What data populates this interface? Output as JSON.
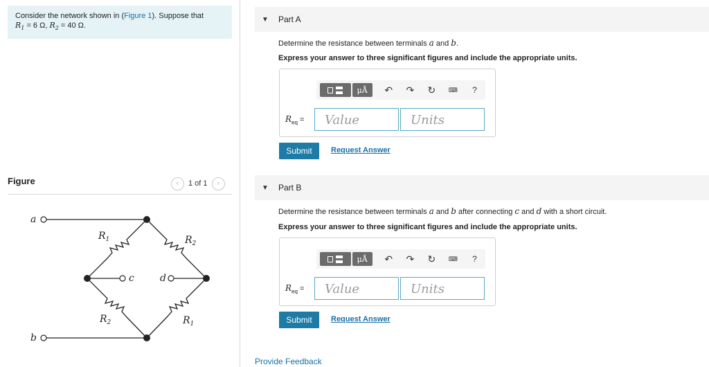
{
  "problem": {
    "text_prefix": "Consider the network shown in (",
    "figure_link": "Figure 1",
    "text_suffix": "). Suppose that",
    "r1_label": "R",
    "r1_sub": "1",
    "r1_value": " = 6 Ω",
    "separator": ", ",
    "r2_label": "R",
    "r2_sub": "2",
    "r2_value": " = 40 Ω."
  },
  "figure": {
    "title": "Figure",
    "page_indicator": "1 of 1",
    "prev_icon": "chevron-left-icon",
    "next_icon": "chevron-right-icon",
    "terminal_a": "a",
    "terminal_b": "b",
    "terminal_c": "c",
    "terminal_d": "d",
    "res_top_left": "R",
    "res_top_left_sub": "1",
    "res_top_right": "R",
    "res_top_right_sub": "2",
    "res_bottom_left": "R",
    "res_bottom_left_sub": "2",
    "res_bottom_right": "R",
    "res_bottom_right_sub": "1"
  },
  "part_a": {
    "title": "Part A",
    "question_prefix": "Determine the resistance between terminals ",
    "q_a": "a",
    "q_and": " and ",
    "q_b": "b",
    "q_end": ".",
    "instruction": "Express your answer to three significant figures and include the appropriate units.",
    "req_label": "R",
    "req_sub": "eq",
    "req_eq": "=",
    "value_placeholder": "Value",
    "units_placeholder": "Units",
    "mu_button": "μÅ",
    "help_button": "?",
    "submit": "Submit",
    "request_answer": "Request Answer"
  },
  "part_b": {
    "title": "Part B",
    "question_prefix": "Determine the resistance between terminals ",
    "q_a": "a",
    "q_and": " and ",
    "q_b": "b",
    "q_mid": " after connecting ",
    "q_c": "c",
    "q_and2": " and ",
    "q_d": "d",
    "q_end": " with a short circuit.",
    "instruction": "Express your answer to three significant figures and include the appropriate units.",
    "req_label": "R",
    "req_sub": "eq",
    "req_eq": "=",
    "value_placeholder": "Value",
    "units_placeholder": "Units",
    "mu_button": "μÅ",
    "help_button": "?",
    "submit": "Submit",
    "request_answer": "Request Answer"
  },
  "toolbar_icons": {
    "undo": "↶",
    "redo": "↷",
    "reset": "↻",
    "keyboard": "⌨"
  },
  "footer": {
    "feedback": "Provide Feedback"
  },
  "colors": {
    "accent": "#1d7ba5",
    "link": "#1a6fa6",
    "problem_bg": "#e5f3f6",
    "input_border": "#5aa6c6"
  }
}
